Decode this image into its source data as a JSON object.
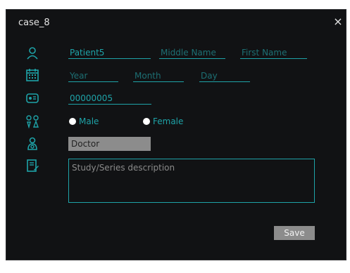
{
  "dialog": {
    "title": "case_8",
    "close_glyph": "×"
  },
  "form": {
    "last_name": "Patient5",
    "middle_name_placeholder": "Middle Name",
    "first_name_placeholder": "First Name",
    "year_placeholder": "Year",
    "month_placeholder": "Month",
    "day_placeholder": "Day",
    "patient_id": "00000005",
    "sex_options": [
      "Male",
      "Female"
    ],
    "doctor": "Doctor",
    "description_placeholder": "Study/Series description"
  },
  "actions": {
    "save_label": "Save"
  },
  "icons": [
    "person-icon",
    "calendar-icon",
    "id-card-icon",
    "gender-icon",
    "doctor-icon",
    "notes-icon"
  ],
  "colors": {
    "accent": "#1ea3a8",
    "placeholder": "#1d6f73",
    "background": "#111214",
    "control_gray": "#8c8c8c"
  }
}
